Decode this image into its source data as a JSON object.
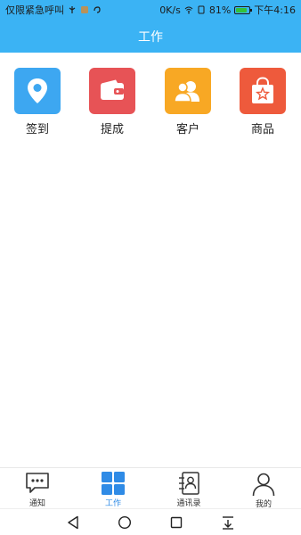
{
  "status_bar": {
    "carrier_text": "仅限紧急呼叫",
    "network_speed": "0K/s",
    "battery_percent": "81%",
    "time": "下午4:16"
  },
  "header": {
    "title": "工作"
  },
  "features": [
    {
      "label": "签到",
      "icon": "location-pin-icon",
      "color": "#3da7f1"
    },
    {
      "label": "提成",
      "icon": "wallet-icon",
      "color": "#e75356"
    },
    {
      "label": "客户",
      "icon": "users-icon",
      "color": "#f8a824"
    },
    {
      "label": "商品",
      "icon": "shopping-bag-icon",
      "color": "#ee5a3c"
    }
  ],
  "tabbar": {
    "items": [
      {
        "label": "通知",
        "icon": "chat-bubble-icon",
        "active": false
      },
      {
        "label": "工作",
        "icon": "grid-icon",
        "active": true
      },
      {
        "label": "通讯录",
        "icon": "contacts-book-icon",
        "active": false
      },
      {
        "label": "我的",
        "icon": "person-icon",
        "active": false
      }
    ]
  },
  "navbar": {
    "items": [
      "back-icon",
      "home-icon",
      "recents-icon",
      "notification-shade-icon"
    ]
  }
}
